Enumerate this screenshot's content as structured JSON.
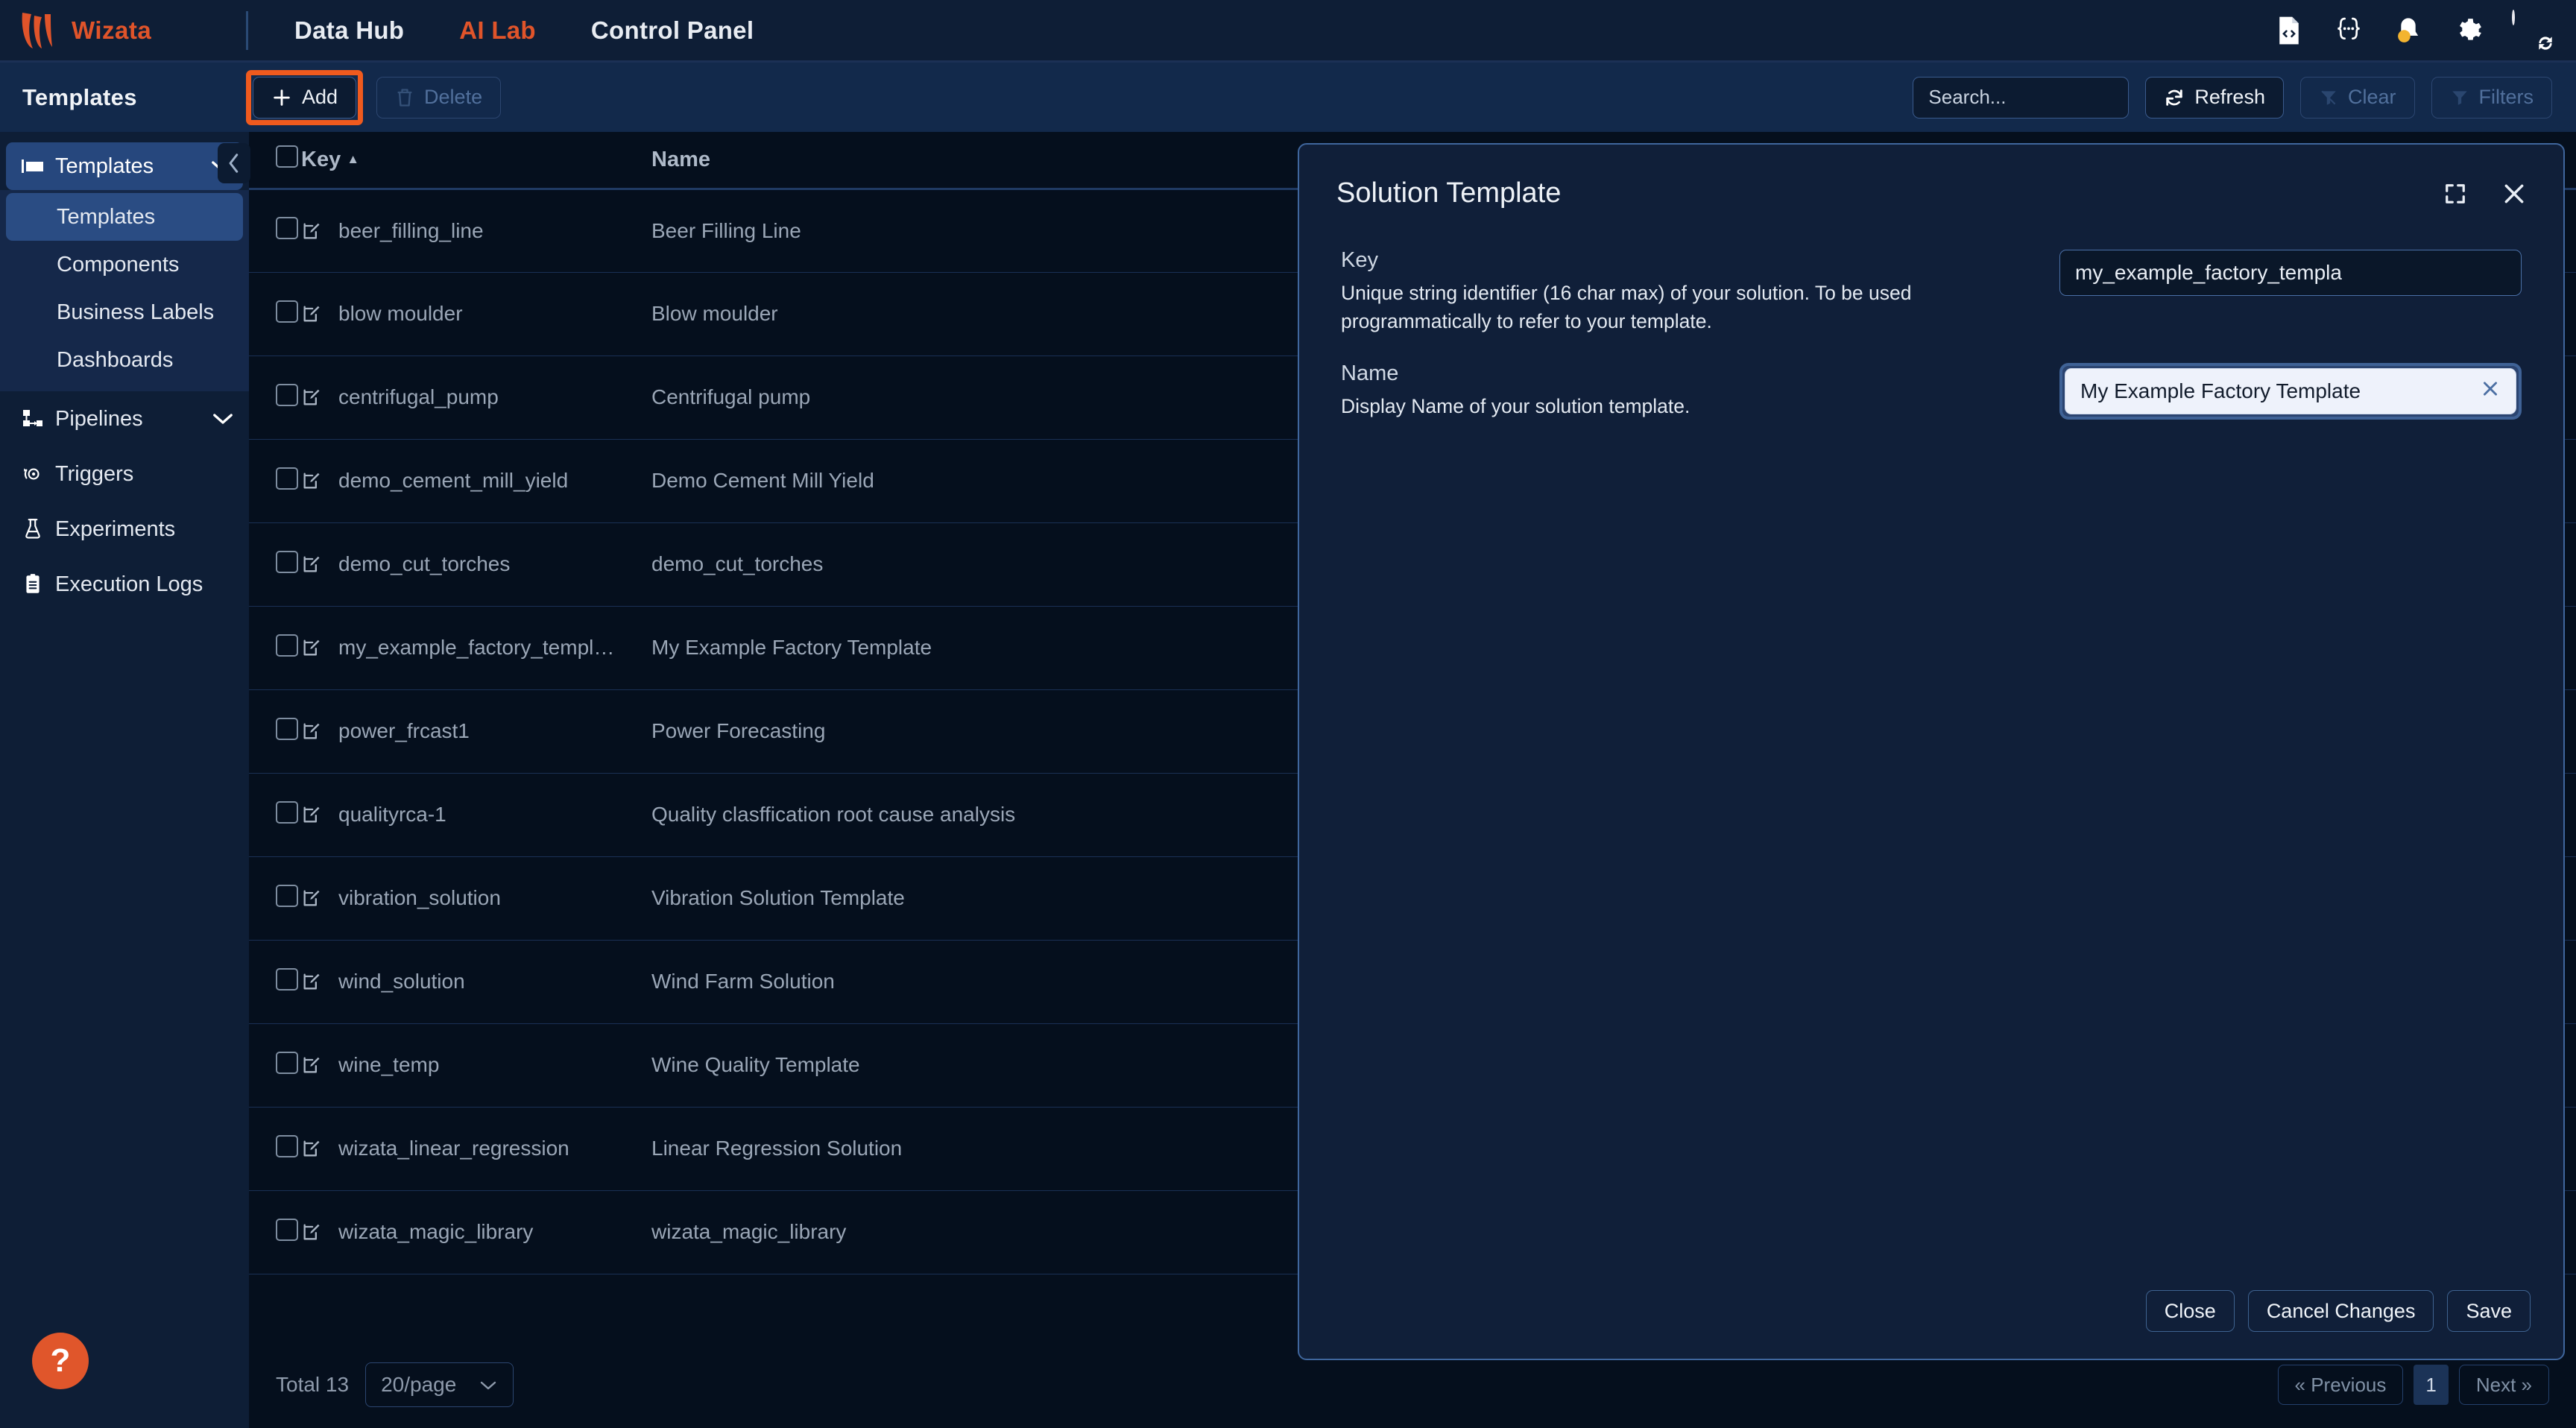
{
  "topnav": {
    "brand": "Wizata",
    "items": [
      {
        "label": "Data Hub",
        "active": false
      },
      {
        "label": "AI Lab",
        "active": true
      },
      {
        "label": "Control Panel",
        "active": false
      }
    ],
    "icons": [
      "code-file-icon",
      "braces-icon",
      "bell-icon",
      "gear-icon",
      "avatar"
    ]
  },
  "toolbar": {
    "page_title": "Templates",
    "add_label": "Add",
    "delete_label": "Delete",
    "search_placeholder": "Search...",
    "refresh_label": "Refresh",
    "clear_label": "Clear",
    "filters_label": "Filters",
    "highlight_color": "#ef5a1e"
  },
  "sidebar": {
    "group": {
      "label": "Templates",
      "icon": "templates-icon",
      "expanded": true
    },
    "sub_items": [
      {
        "label": "Templates",
        "active": true
      },
      {
        "label": "Components",
        "active": false
      },
      {
        "label": "Business Labels",
        "active": false
      },
      {
        "label": "Dashboards",
        "active": false
      }
    ],
    "items": [
      {
        "label": "Pipelines",
        "icon": "pipelines-icon",
        "chevron": true
      },
      {
        "label": "Triggers",
        "icon": "triggers-icon",
        "chevron": false
      },
      {
        "label": "Experiments",
        "icon": "flask-icon",
        "chevron": false
      },
      {
        "label": "Execution Logs",
        "icon": "logs-icon",
        "chevron": false
      }
    ]
  },
  "table": {
    "columns": [
      "Key",
      "Name"
    ],
    "sort_column": "Key",
    "sort_direction": "asc",
    "rows": [
      {
        "key": "beer_filling_line",
        "name": "Beer Filling Line"
      },
      {
        "key": "blow moulder",
        "name": "Blow moulder"
      },
      {
        "key": "centrifugal_pump",
        "name": "Centrifugal pump"
      },
      {
        "key": "demo_cement_mill_yield",
        "name": "Demo Cement Mill Yield"
      },
      {
        "key": "demo_cut_torches",
        "name": "demo_cut_torches"
      },
      {
        "key": "my_example_factory_templ…",
        "name": "My Example Factory Template"
      },
      {
        "key": "power_frcast1",
        "name": "Power Forecasting"
      },
      {
        "key": "qualityrca-1",
        "name": "Quality clasffication root cause analysis"
      },
      {
        "key": "vibration_solution",
        "name": "Vibration Solution Template"
      },
      {
        "key": "wind_solution",
        "name": "Wind Farm Solution"
      },
      {
        "key": "wine_temp",
        "name": "Wine Quality Template"
      },
      {
        "key": "wizata_linear_regression",
        "name": "Linear Regression Solution"
      },
      {
        "key": "wizata_magic_library",
        "name": "wizata_magic_library"
      }
    ]
  },
  "footer": {
    "total_label": "Total 13",
    "page_size": "20/page",
    "previous_label": "« Previous",
    "current_page": "1",
    "next_label": "Next »"
  },
  "help": {
    "label": "?"
  },
  "dialog": {
    "title": "Solution Template",
    "expand_icon": "expand-icon",
    "close_icon": "close-icon",
    "fields": [
      {
        "label": "Key",
        "description": "Unique string identifier (16 char max) of your solution. To be used programmatically to refer to your template.",
        "value": "my_example_factory_templa"
      },
      {
        "label": "Name",
        "description": "Display Name of your solution template.",
        "value": "My Example Factory Template",
        "clear_icon": "clear-icon"
      }
    ],
    "buttons": [
      {
        "label": "Close"
      },
      {
        "label": "Cancel Changes"
      },
      {
        "label": "Save"
      }
    ]
  }
}
